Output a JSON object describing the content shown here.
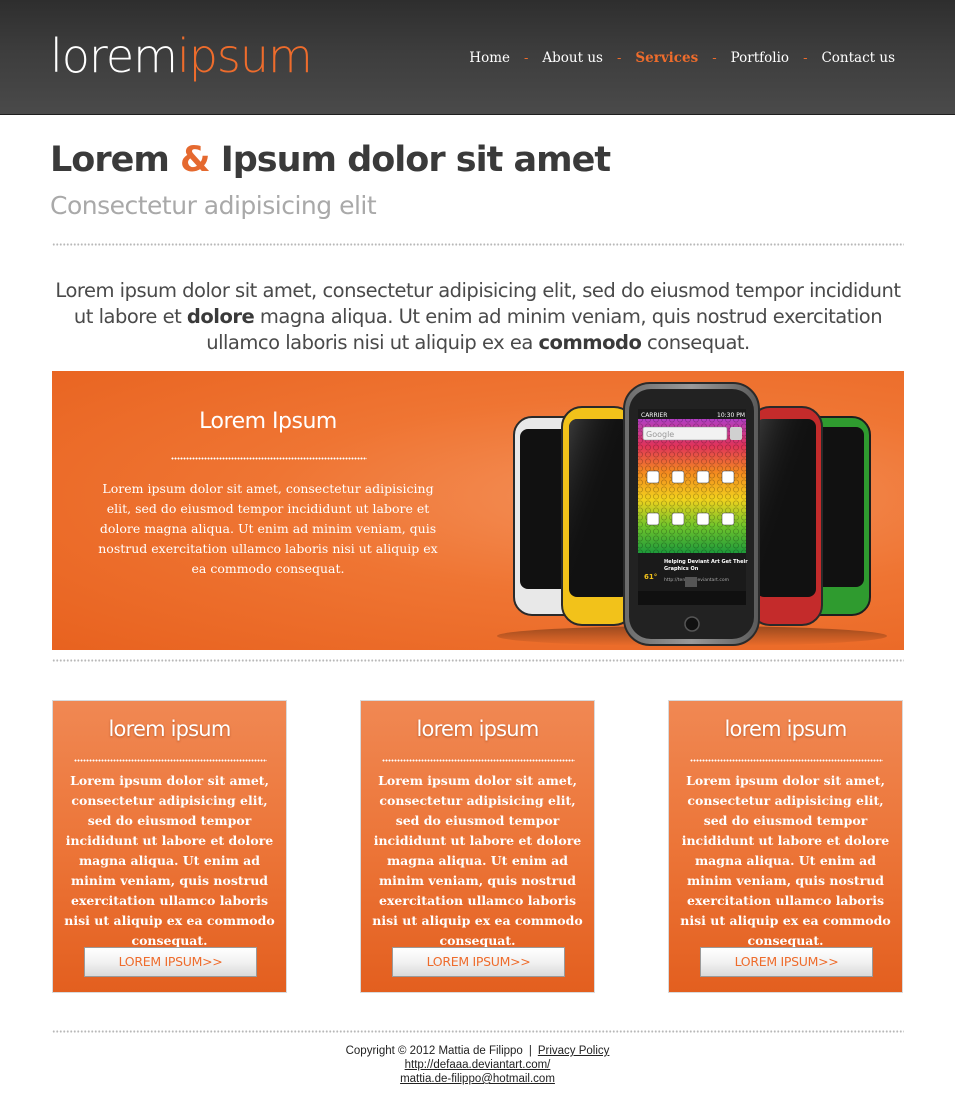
{
  "brand": {
    "logo_left": "lorem",
    "logo_right": "ipsum",
    "accent": "#ee6c2c"
  },
  "nav": {
    "items": [
      {
        "label": "Home",
        "active": false
      },
      {
        "label": "About us",
        "active": false
      },
      {
        "label": "Services",
        "active": true
      },
      {
        "label": "Portfolio",
        "active": false
      },
      {
        "label": "Contact us",
        "active": false
      }
    ],
    "separator": "-"
  },
  "heading": {
    "title_part1": "Lorem ",
    "title_amp": "&",
    "title_part2": " Ipsum dolor sit amet",
    "subtitle": "Consectetur adipisicing elit"
  },
  "intro": {
    "part1": "Lorem ipsum dolor sit amet, consectetur adipisicing elit, sed do eiusmod tempor incididunt ut labore et ",
    "bold1": "dolore",
    "part2": " magna aliqua. Ut enim ad minim veniam, quis nostrud exercitation ullamco laboris nisi ut aliquip ex ea ",
    "bold2": "commodo",
    "part3": " consequat."
  },
  "hero": {
    "title": "Lorem Ipsum",
    "text": "Lorem ipsum dolor sit amet, consectetur adipisicing elit, sed do eiusmod tempor incididunt ut labore et dolore magna aliqua. Ut enim ad minim veniam, quis nostrud exercitation ullamco laboris nisi ut aliquip ex ea commodo consequat.",
    "phone": {
      "carrier": "CARRIER",
      "time": "10:30 PM",
      "search": "Google",
      "temp": "61°",
      "widget_line1": "Helping Deviant Art Get Their",
      "widget_line2": "Graphics On",
      "widget_url": "http://tenshu.deviantart.com"
    }
  },
  "features": [
    {
      "title": "lorem ipsum",
      "text": "Lorem ipsum dolor sit amet, consectetur adipisicing elit, sed do eiusmod tempor incididunt ut labore et dolore magna aliqua. Ut enim ad minim veniam, quis nostrud exercitation ullamco laboris nisi ut aliquip ex ea commodo consequat.",
      "button": "LOREM IPSUM>>"
    },
    {
      "title": "lorem ipsum",
      "text": "Lorem ipsum dolor sit amet, consectetur adipisicing elit, sed do eiusmod tempor incididunt ut labore et dolore magna aliqua. Ut enim ad minim veniam, quis nostrud exercitation ullamco laboris nisi ut aliquip ex ea commodo consequat.",
      "button": "LOREM IPSUM>>"
    },
    {
      "title": "lorem ipsum",
      "text": "Lorem ipsum dolor sit amet, consectetur adipisicing elit, sed do eiusmod tempor incididunt ut labore et dolore magna aliqua. Ut enim ad minim veniam, quis nostrud exercitation ullamco laboris nisi ut aliquip ex ea commodo consequat.",
      "button": "LOREM IPSUM>>"
    }
  ],
  "footer": {
    "copyright": "Copyright © 2012 Mattia de Filippo",
    "separator": "|",
    "privacy": "Privacy Policy",
    "link": "http://defaaa.deviantart.com/",
    "email": "mattia.de-filippo@hotmail.com"
  }
}
